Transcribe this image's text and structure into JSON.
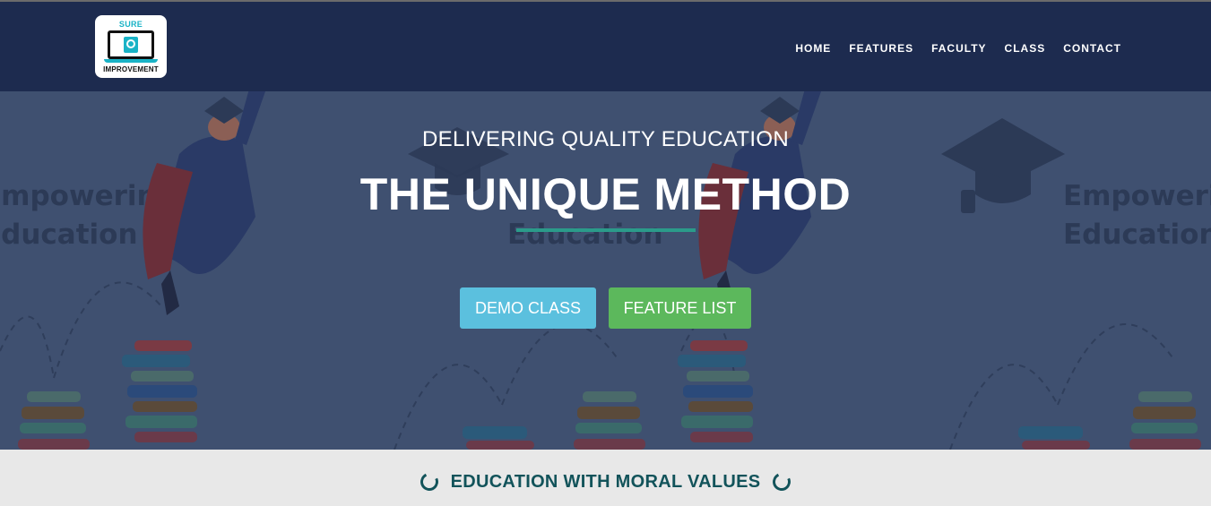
{
  "logo": {
    "top_text": "SURE",
    "bottom_text": "IMPROVEMENT"
  },
  "nav": {
    "items": [
      {
        "label": "HOME"
      },
      {
        "label": "FEATURES"
      },
      {
        "label": "FACULTY"
      },
      {
        "label": "CLASS"
      },
      {
        "label": "CONTACT"
      }
    ]
  },
  "hero": {
    "subtitle": "DELIVERING QUALITY EDUCATION",
    "title": "THE UNIQUE METHOD",
    "background_words": [
      "Empowering",
      "Education"
    ],
    "buttons": {
      "demo": "DEMO CLASS",
      "features": "FEATURE LIST"
    }
  },
  "band": {
    "text": "EDUCATION WITH MORAL VALUES"
  },
  "colors": {
    "navbar": "#1d2b4f",
    "hero_overlay": "#3f5070",
    "accent_teal": "#2b9b8a",
    "button_info": "#5bc0de",
    "button_success": "#5cb85c",
    "band_text": "#12535a"
  }
}
